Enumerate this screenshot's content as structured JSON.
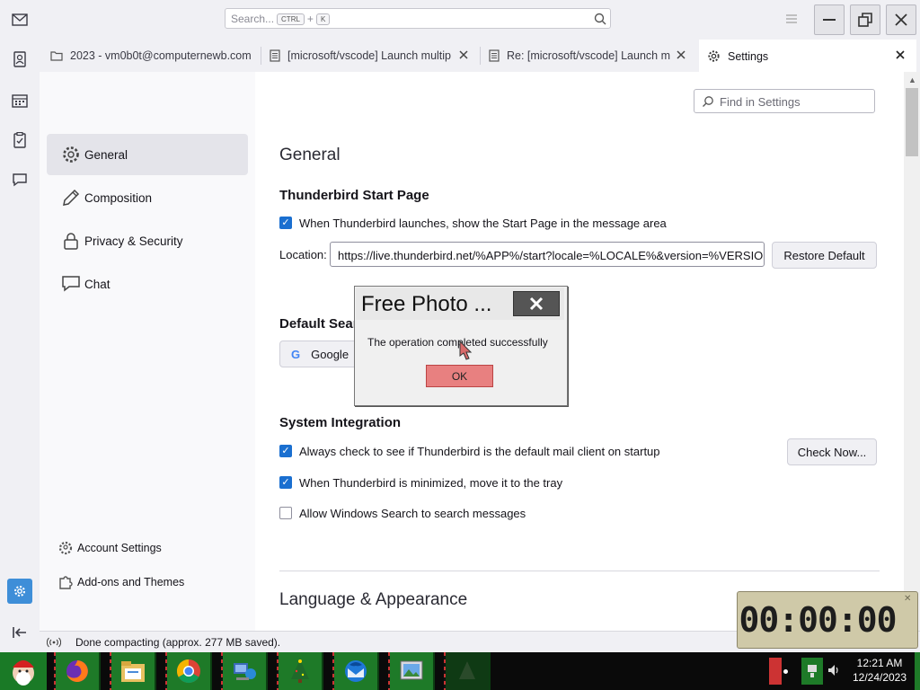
{
  "window": {
    "search_placeholder": "Search...",
    "search_key1": "CTRL",
    "search_plus": "+",
    "search_key2": "K"
  },
  "tabs": [
    {
      "label": "2023 - vm0b0t@computernewb.com",
      "icon": "folder-icon"
    },
    {
      "label": "[microsoft/vscode] Launch multip",
      "icon": "document-icon"
    },
    {
      "label": "Re: [microsoft/vscode] Launch m",
      "icon": "document-icon"
    },
    {
      "label": "Settings",
      "icon": "gear-icon"
    }
  ],
  "settings_search_placeholder": "Find in Settings",
  "sidebar": {
    "items": [
      {
        "label": "General",
        "icon": "gear-icon"
      },
      {
        "label": "Composition",
        "icon": "pencil-icon"
      },
      {
        "label": "Privacy & Security",
        "icon": "lock-icon"
      },
      {
        "label": "Chat",
        "icon": "chat-bubble-icon"
      }
    ],
    "footer": [
      {
        "label": "Account Settings",
        "icon": "account-gear-icon"
      },
      {
        "label": "Add-ons and Themes",
        "icon": "puzzle-icon"
      }
    ]
  },
  "main": {
    "section_title": "General",
    "start_page": {
      "heading": "Thunderbird Start Page",
      "show_checkbox_label": "When Thunderbird launches, show the Start Page in the message area",
      "location_label": "Location:",
      "location_value": "https://live.thunderbird.net/%APP%/start?locale=%LOCALE%&version=%VERSIO",
      "restore_button": "Restore Default"
    },
    "default_search": {
      "heading": "Default Sear",
      "engine": "Google"
    },
    "system_integration": {
      "heading": "System Integration",
      "always_check_label": "Always check to see if Thunderbird is the default mail client on startup",
      "check_now_button": "Check Now...",
      "minimized_label": "When Thunderbird is minimized, move it to the tray",
      "windows_search_label": "Allow Windows Search to search messages"
    },
    "language_title": "Language & Appearance"
  },
  "status": {
    "text": "Done compacting (approx. 277 MB saved)."
  },
  "dialog": {
    "title": "Free Photo ...",
    "message": "The operation completed successfully",
    "ok_button": "OK"
  },
  "timer": {
    "display": "00:00:00"
  },
  "taskbar": {
    "time": "12:21 AM",
    "date": "12/24/2023"
  },
  "colors": {
    "accent": "#1a6fd0",
    "spaces_active": "#3e8ed8",
    "ok_button": "#e88080",
    "taskbar_app": "#1e7a28"
  }
}
